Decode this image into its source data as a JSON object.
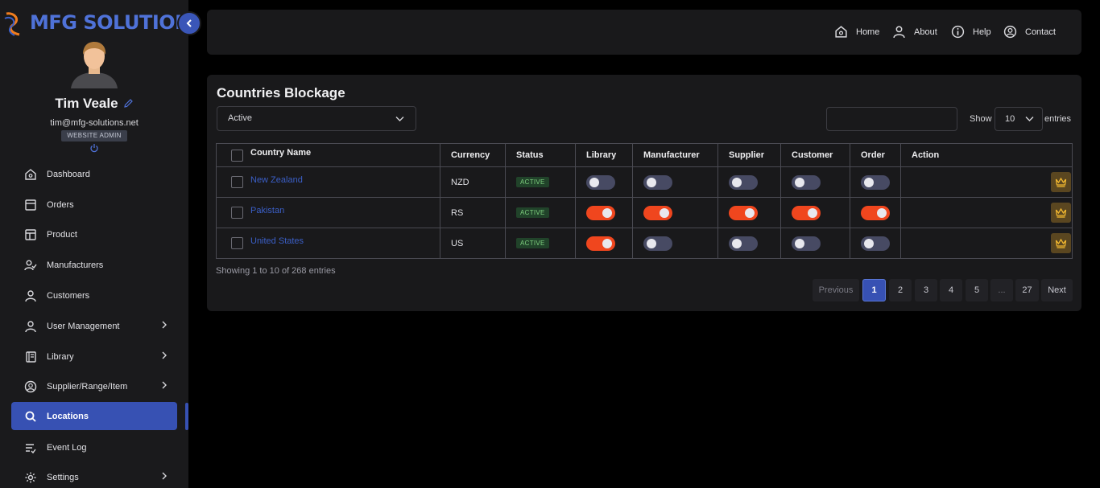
{
  "brand": {
    "name": "MFG SOLUTION"
  },
  "user": {
    "name": "Tim Veale",
    "email": "tim@mfg-solutions.net",
    "role": "WEBSITE ADMIN"
  },
  "sidebar": {
    "items": [
      {
        "label": "Dashboard",
        "icon": "home-icon",
        "has_submenu": false,
        "active": false
      },
      {
        "label": "Orders",
        "icon": "orders-icon",
        "has_submenu": false,
        "active": false
      },
      {
        "label": "Product",
        "icon": "layout-icon",
        "has_submenu": false,
        "active": false
      },
      {
        "label": "Manufacturers",
        "icon": "user-check-icon",
        "has_submenu": false,
        "active": false
      },
      {
        "label": "Customers",
        "icon": "user-icon",
        "has_submenu": false,
        "active": false
      },
      {
        "label": "User Management",
        "icon": "user-icon",
        "has_submenu": true,
        "active": false
      },
      {
        "label": "Library",
        "icon": "book-icon",
        "has_submenu": true,
        "active": false
      },
      {
        "label": "Supplier/Range/Item",
        "icon": "user-circle-icon",
        "has_submenu": true,
        "active": false
      },
      {
        "label": "Locations",
        "icon": "search-icon",
        "has_submenu": false,
        "active": true
      },
      {
        "label": "Event Log",
        "icon": "list-icon",
        "has_submenu": false,
        "active": false
      },
      {
        "label": "Settings",
        "icon": "gear-icon",
        "has_submenu": true,
        "active": false
      }
    ]
  },
  "topnav": {
    "home": "Home",
    "about": "About",
    "help": "Help",
    "contact": "Contact"
  },
  "card": {
    "title": "Countries Blockage",
    "status_filter": "Active",
    "search_value": "",
    "show_label": "Show",
    "entries_value": "10",
    "entries_label": "entries"
  },
  "table": {
    "columns": [
      "Country Name",
      "Currency",
      "Status",
      "Library",
      "Manufacturer",
      "Supplier",
      "Customer",
      "Order",
      "Action"
    ],
    "rows": [
      {
        "country": "New Zealand",
        "currency": "NZD",
        "status": "ACTIVE",
        "library": false,
        "manufacturer": false,
        "supplier": false,
        "customer": false,
        "order": false
      },
      {
        "country": "Pakistan",
        "currency": "RS",
        "status": "ACTIVE",
        "library": true,
        "manufacturer": true,
        "supplier": true,
        "customer": true,
        "order": true
      },
      {
        "country": "United States",
        "currency": "US",
        "status": "ACTIVE",
        "library": true,
        "manufacturer": false,
        "supplier": false,
        "customer": false,
        "order": false
      }
    ]
  },
  "footer": {
    "info": "Showing 1 to 10 of 268 entries",
    "pagination": {
      "previous": "Previous",
      "pages": [
        "1",
        "2",
        "3",
        "4",
        "5",
        "...",
        "27"
      ],
      "current": "1",
      "next": "Next"
    }
  },
  "colors": {
    "accent": "#3751b3",
    "toggle_on": "#f0461e",
    "toggle_off": "#474a63",
    "badge_active": "#7fd07f",
    "link": "#3b5fc7"
  }
}
